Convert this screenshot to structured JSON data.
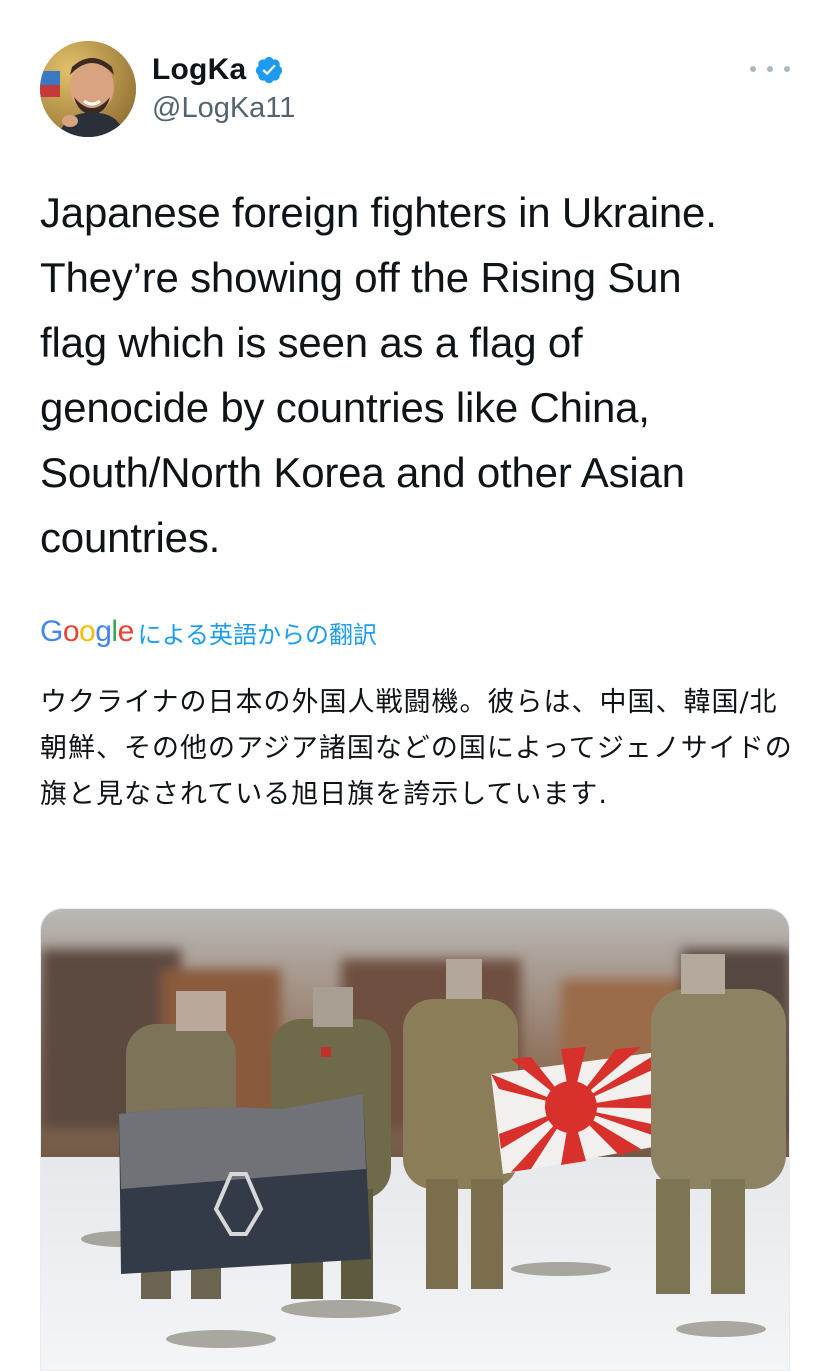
{
  "author": {
    "display_name": "LogKa",
    "handle": "@LogKa11",
    "verified": true,
    "avatar": "profile-photo"
  },
  "tweet": {
    "text": "Japanese foreign fighters in Ukraine.\nThey’re showing off the Rising Sun\nflag which is seen as a flag of\ngenocide by countries like China,\nSouth/North Korea and other Asian\ncountries."
  },
  "translation": {
    "provider": "Google",
    "note": "による英語からの翻訳",
    "text": "ウクライナの日本の外国人戦闘機。彼らは、中国、韓国/北朝鮮、その他のアジア諸国などの国によってジェノサイドの旗と見なされている旭日旗を誇示しています."
  },
  "media": {
    "alt": "",
    "type": "photo"
  },
  "colors": {
    "text": "#0f1419",
    "secondary": "#536471",
    "link": "#1d9bf0",
    "verified": "#1d9bf0"
  },
  "icons": {
    "verified": "verified-badge-icon",
    "more": "more-options-icon"
  }
}
